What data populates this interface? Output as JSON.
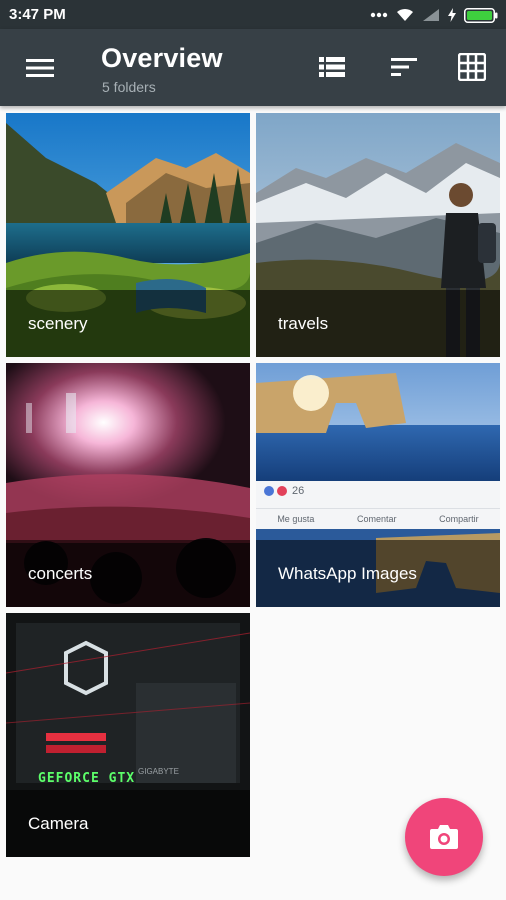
{
  "status_bar": {
    "time": "3:47 PM",
    "icons": [
      "more-dots-icon",
      "wifi-icon",
      "cell-signal-icon",
      "charging-icon",
      "battery-icon"
    ]
  },
  "app_bar": {
    "title": "Overview",
    "subtitle": "5 folders",
    "actions": [
      "list-view-icon",
      "sort-icon",
      "grid-view-icon"
    ]
  },
  "folders": [
    {
      "name": "scenery"
    },
    {
      "name": "travels"
    },
    {
      "name": "concerts"
    },
    {
      "name": "WhatsApp Images"
    },
    {
      "name": "Camera"
    }
  ],
  "whatsapp_preview": {
    "reaction_count": "26",
    "like_label": "Me gusta",
    "comment_label": "Comentar",
    "share_label": "Compartir"
  },
  "camera_preview": {
    "gpu_text": "GEFORCE GTX",
    "brand_text": "GIGABYTE"
  },
  "colors": {
    "status_bar": "#2b3337",
    "app_bar": "#374046",
    "fab": "#f0457a",
    "background": "#fafafa"
  }
}
